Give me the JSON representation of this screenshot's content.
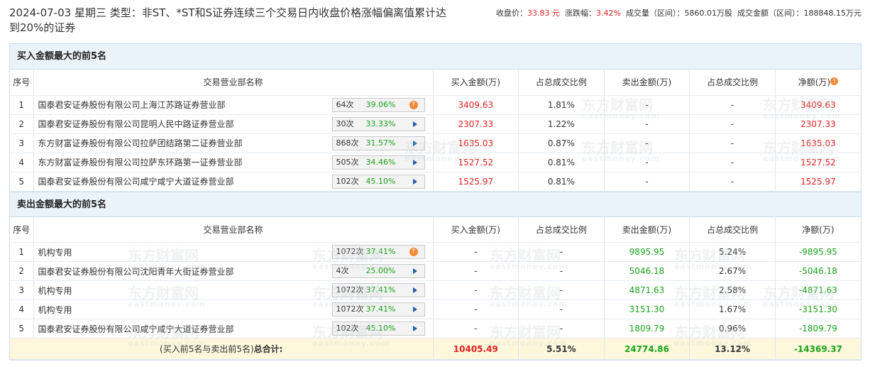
{
  "header": {
    "title": "2024-07-03 星期三 类型：非ST、*ST和S证券连续三个交易日内收盘价格涨幅偏离值累计达到20%的证券",
    "close_label": "收盘价：",
    "close_value": "33.83 元",
    "change_label": "涨跌幅：",
    "change_value": "3.42%",
    "volume_label": "成交量（区间）：",
    "volume_value": "5860.01万股",
    "amount_label": "成交金额（区间）：",
    "amount_value": "188848.15万元"
  },
  "watermark": {
    "cn": "东方财富网",
    "en": "eastmoney.com"
  },
  "columns": {
    "no": "序号",
    "name": "交易营业部名称",
    "buy": "买入金额(万)",
    "buy_ratio": "占总成交比例",
    "sell": "卖出金额(万)",
    "sell_ratio": "占总成交比例",
    "net": "净额(万)"
  },
  "buy_section": {
    "title": "买入金额最大的前5名",
    "rows": [
      {
        "no": "1",
        "name": "国泰君安证券股份有限公司上海江苏路证券营业部",
        "count": "64次",
        "pct": "39.06%",
        "icon": "question-icon",
        "buy": "3409.63",
        "buy_ratio": "1.81%",
        "sell": "-",
        "sell_ratio": "-",
        "net": "3409.63"
      },
      {
        "no": "2",
        "name": "国泰君安证券股份有限公司昆明人民中路证券营业部",
        "count": "30次",
        "pct": "33.33%",
        "icon": "arrow-right-icon",
        "buy": "2307.33",
        "buy_ratio": "1.22%",
        "sell": "-",
        "sell_ratio": "-",
        "net": "2307.33"
      },
      {
        "no": "3",
        "name": "东方财富证券股份有限公司拉萨团结路第二证券营业部",
        "count": "868次",
        "pct": "31.57%",
        "icon": "arrow-right-icon",
        "buy": "1635.03",
        "buy_ratio": "0.87%",
        "sell": "-",
        "sell_ratio": "-",
        "net": "1635.03"
      },
      {
        "no": "4",
        "name": "东方财富证券股份有限公司拉萨东环路第一证券营业部",
        "count": "505次",
        "pct": "34.46%",
        "icon": "arrow-right-icon",
        "buy": "1527.52",
        "buy_ratio": "0.81%",
        "sell": "-",
        "sell_ratio": "-",
        "net": "1527.52"
      },
      {
        "no": "5",
        "name": "国泰君安证券股份有限公司咸宁咸宁大道证券营业部",
        "count": "102次",
        "pct": "45.10%",
        "icon": "arrow-right-icon",
        "buy": "1525.97",
        "buy_ratio": "0.81%",
        "sell": "-",
        "sell_ratio": "-",
        "net": "1525.97"
      }
    ]
  },
  "sell_section": {
    "title": "卖出金额最大的前5名",
    "rows": [
      {
        "no": "1",
        "name": "机构专用",
        "count": "1072次",
        "pct": "37.41%",
        "icon": "question-icon",
        "buy": "-",
        "buy_ratio": "-",
        "sell": "9895.95",
        "sell_ratio": "5.24%",
        "net": "-9895.95"
      },
      {
        "no": "2",
        "name": "国泰君安证券股份有限公司沈阳青年大街证券营业部",
        "count": "4次",
        "pct": "25.00%",
        "icon": "arrow-right-icon",
        "buy": "-",
        "buy_ratio": "-",
        "sell": "5046.18",
        "sell_ratio": "2.67%",
        "net": "-5046.18"
      },
      {
        "no": "3",
        "name": "机构专用",
        "count": "1072次",
        "pct": "37.41%",
        "icon": "arrow-right-icon",
        "buy": "-",
        "buy_ratio": "-",
        "sell": "4871.63",
        "sell_ratio": "2.58%",
        "net": "-4871.63"
      },
      {
        "no": "4",
        "name": "机构专用",
        "count": "1072次",
        "pct": "37.41%",
        "icon": "arrow-right-icon",
        "buy": "-",
        "buy_ratio": "-",
        "sell": "3151.30",
        "sell_ratio": "1.67%",
        "net": "-3151.30"
      },
      {
        "no": "5",
        "name": "国泰君安证券股份有限公司咸宁咸宁大道证券营业部",
        "count": "102次",
        "pct": "45.10%",
        "icon": "arrow-right-icon",
        "buy": "-",
        "buy_ratio": "-",
        "sell": "1809.79",
        "sell_ratio": "0.96%",
        "net": "-1809.79"
      }
    ]
  },
  "total": {
    "label_prefix": "(买入前5名与卖出前5名)",
    "label_bold": "总合计:",
    "buy": "10405.49",
    "buy_ratio": "5.51%",
    "sell": "24774.86",
    "sell_ratio": "13.12%",
    "net": "-14369.37"
  },
  "colors": {
    "up": "#e02020",
    "down": "#1aa31a",
    "header_bg": "#eaf2fa",
    "total_bg": "#fdf7dc"
  }
}
